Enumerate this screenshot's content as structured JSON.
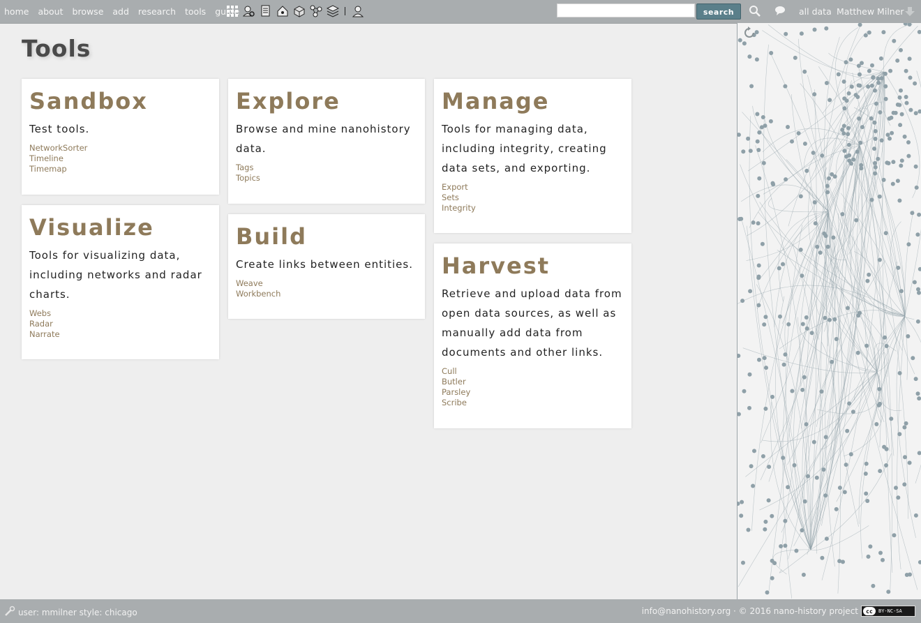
{
  "nav": {
    "links": [
      "home",
      "about",
      "browse",
      "add",
      "research",
      "tools",
      "guide"
    ],
    "icons": [
      "grid-icon",
      "person-search-icon",
      "document-icon",
      "home-network-icon",
      "cube-icon",
      "network-icon",
      "layers-icon",
      "person-network-icon"
    ],
    "search_placeholder": "",
    "search_button": "search",
    "all_data": "all data",
    "user_name": "Matthew Milner"
  },
  "page": {
    "title": "Tools"
  },
  "cards": {
    "sandbox": {
      "title": "Sandbox",
      "desc": "Test tools.",
      "links": [
        "NetworkSorter",
        "Timeline",
        "Timemap"
      ]
    },
    "visualize": {
      "title": "Visualize",
      "desc": "Tools for visualizing data, including networks and radar charts.",
      "links": [
        "Webs",
        "Radar",
        "Narrate"
      ]
    },
    "explore": {
      "title": "Explore",
      "desc": "Browse and mine nanohistory data.",
      "links": [
        "Tags",
        "Topics"
      ]
    },
    "build": {
      "title": "Build",
      "desc": "Create links between entities.",
      "links": [
        "Weave",
        "Workbench"
      ]
    },
    "manage": {
      "title": "Manage",
      "desc": "Tools for managing data, including integrity, creating data sets, and exporting.",
      "links": [
        "Export",
        "Sets",
        "Integrity"
      ]
    },
    "harvest": {
      "title": "Harvest",
      "desc": "Retrieve and upload data from open data sources, as well as manually add data from documents and other links.",
      "links": [
        "Cull",
        "Butler",
        "Parsley",
        "Scribe"
      ]
    }
  },
  "footer": {
    "status": "user: mmilner style: chicago",
    "contact": "info@nanohistory.org · © 2016 nano-history project",
    "license": "BY-NC-SA"
  },
  "colors": {
    "accent": "#8e7a5a",
    "bar": "#a9adaf",
    "search_button": "#5a7f8a",
    "network": "#8fa0a8"
  }
}
